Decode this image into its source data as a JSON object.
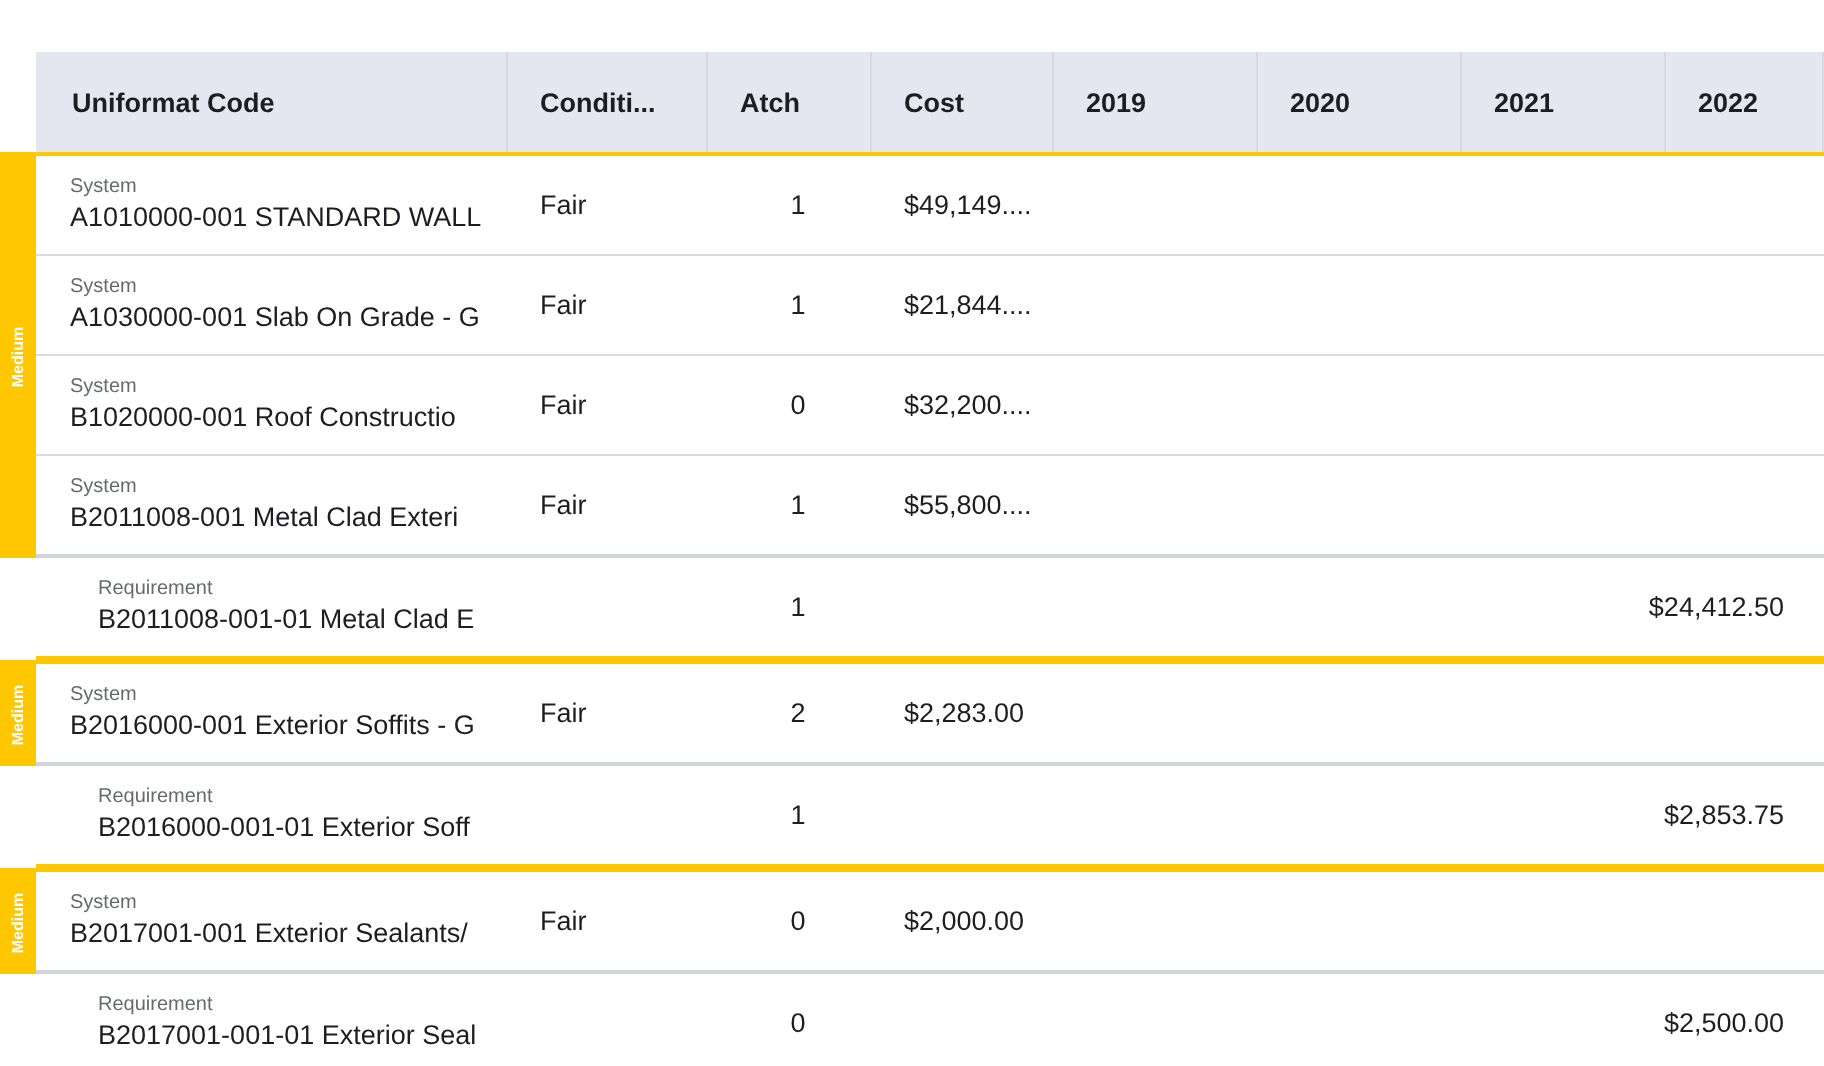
{
  "table": {
    "columns": [
      "Uniformat Code",
      "Conditi...",
      "Atch",
      "Cost",
      "2019",
      "2020",
      "2021",
      "2022"
    ],
    "groups": [
      {
        "priority": "Medium",
        "systems": [
          {
            "type": "System",
            "code": "A1010000-001 STANDARD WALL",
            "condition": "Fair",
            "attachments": "1",
            "cost": "$49,149...."
          },
          {
            "type": "System",
            "code": "A1030000-001 Slab On Grade - G",
            "condition": "Fair",
            "attachments": "1",
            "cost": "$21,844...."
          },
          {
            "type": "System",
            "code": "B1020000-001 Roof Constructio",
            "condition": "Fair",
            "attachments": "0",
            "cost": "$32,200...."
          },
          {
            "type": "System",
            "code": "B2011008-001 Metal Clad Exteri",
            "condition": "Fair",
            "attachments": "1",
            "cost": "$55,800...."
          }
        ],
        "requirements": [
          {
            "type": "Requirement",
            "code": "B2011008-001-01 Metal Clad E",
            "attachments": "1",
            "year_4": "$24,412.50"
          }
        ]
      },
      {
        "priority": "Medium",
        "systems": [
          {
            "type": "System",
            "code": "B2016000-001 Exterior Soffits - G",
            "condition": "Fair",
            "attachments": "2",
            "cost": "$2,283.00"
          }
        ],
        "requirements": [
          {
            "type": "Requirement",
            "code": "B2016000-001-01 Exterior Soff",
            "attachments": "1",
            "year_4": "$2,853.75"
          }
        ]
      },
      {
        "priority": "Medium",
        "systems": [
          {
            "type": "System",
            "code": "B2017001-001 Exterior Sealants/",
            "condition": "Fair",
            "attachments": "0",
            "cost": "$2,000.00"
          }
        ],
        "requirements": [
          {
            "type": "Requirement",
            "code": "B2017001-001-01 Exterior Seal",
            "attachments": "0",
            "year_4": "$2,500.00"
          }
        ]
      }
    ]
  }
}
